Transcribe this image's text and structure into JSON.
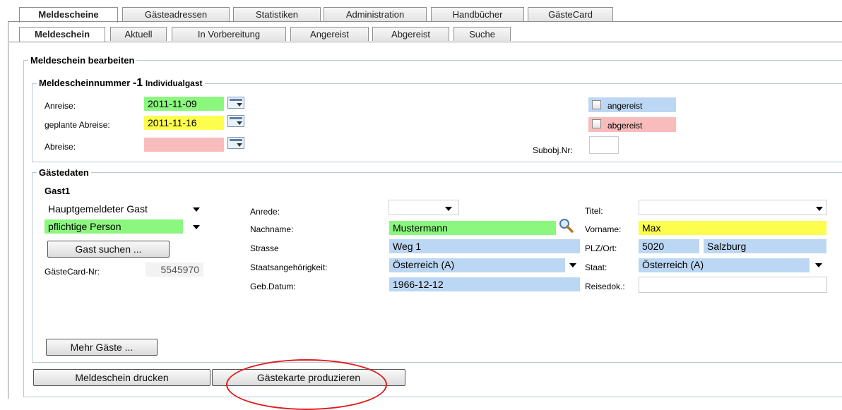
{
  "main_tabs": [
    "Meldescheine",
    "Gästeadressen",
    "Statistiken",
    "Administration",
    "Handbücher",
    "GästeCard"
  ],
  "sub_tabs": [
    "Meldeschein",
    "Aktuell",
    "In Vorbereitung",
    "Angereist",
    "Abgereist",
    "Suche"
  ],
  "form": {
    "legend": "Meldeschein bearbeiten",
    "number": {
      "legend_prefix": "Meldescheinnummer",
      "value": "-1",
      "type": "Individualgast",
      "arrival_label": "Anreise:",
      "arrival_value": "2011-11-09",
      "planned_departure_label": "geplante Abreise:",
      "planned_departure_value": "2011-11-16",
      "departure_label": "Abreise:",
      "departure_value": "",
      "arrived_label": "angereist",
      "departed_label": "abgereist",
      "subobj_label": "Subobj.Nr:",
      "subobj_value": ""
    },
    "guests": {
      "legend": "Gästedaten",
      "guest_title": "Gast1",
      "guest_type": "Hauptgemeldeter Gast",
      "obligation": "pflichtige Person",
      "search_button": "Gast suchen ...",
      "guestcard_label": "GästeCard-Nr:",
      "guestcard_value": "5545970",
      "salutation_label": "Anrede:",
      "salutation_value": "",
      "lastname_label": "Nachname:",
      "lastname_value": "Mustermann",
      "street_label": "Strasse",
      "street_value": "Weg 1",
      "nationality_label": "Staatsangehörigkeit:",
      "nationality_value": "Österreich (A)",
      "birthdate_label": "Geb.Datum:",
      "birthdate_value": "1966-12-12",
      "title_label": "Titel:",
      "title_value": "",
      "firstname_label": "Vorname:",
      "firstname_value": "Max",
      "zipcity_label": "PLZ/Ort:",
      "zip_value": "5020",
      "city_value": "Salzburg",
      "country_label": "Staat:",
      "country_value": "Österreich (A)",
      "traveldoc_label": "Reisedok.:",
      "traveldoc_value": "",
      "more_button": "Mehr Gäste ..."
    },
    "print_button": "Meldeschein drucken",
    "produce_button": "Gästekarte produzieren"
  },
  "colors": {
    "green": "#8cf77f",
    "yellow": "#fdfd4e",
    "pink": "#f8bcbc",
    "blue": "#bcd7f3",
    "annotation_red": "#e31b1b"
  }
}
